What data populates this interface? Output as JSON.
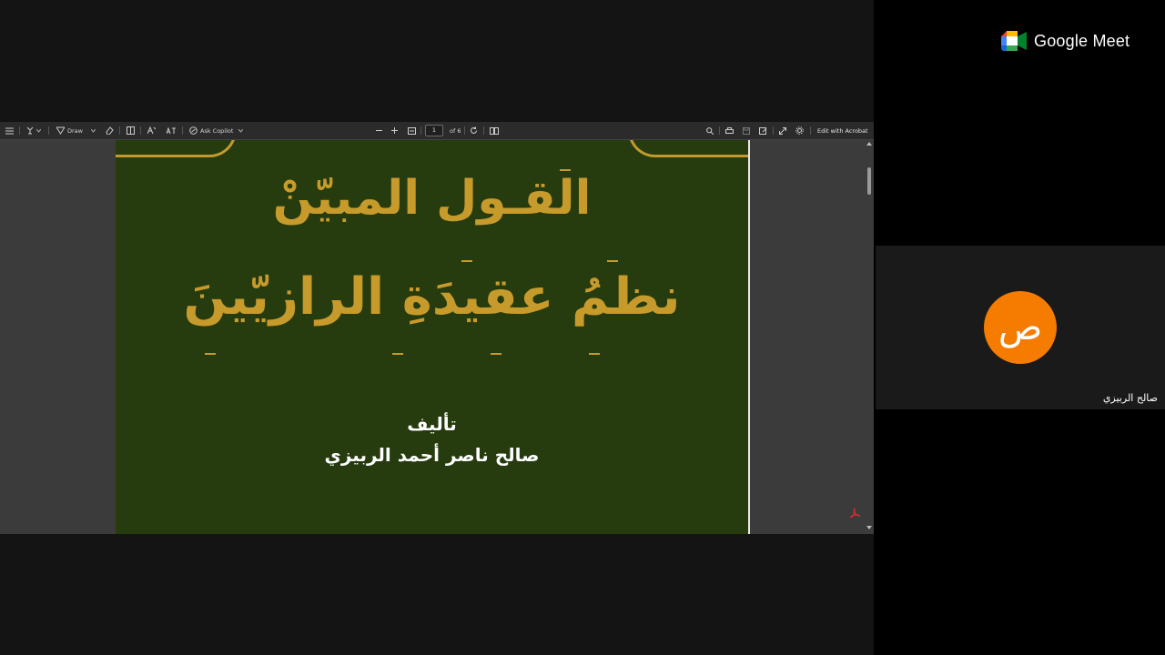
{
  "meet": {
    "brand": "Google Meet",
    "participant": {
      "name": "صالح الربيزي",
      "initial": "ص",
      "avatar_color": "#f57c00"
    }
  },
  "viewer": {
    "toolbar": {
      "draw_label": "Draw",
      "copilot_label": "Ask Copilot",
      "page_current": "1",
      "page_total": "of 6",
      "edit_label": "Edit with Acrobat"
    },
    "page": {
      "title_line1": "القـول المبيّنْ",
      "title_line2": "نظمُ عقيدَةِ الرازيّينَ",
      "author_label": "تأليف",
      "author_name": "صالح ناصر أحمد الربيزي",
      "background_color": "#263b0e",
      "title_color": "#c79b2b"
    }
  }
}
